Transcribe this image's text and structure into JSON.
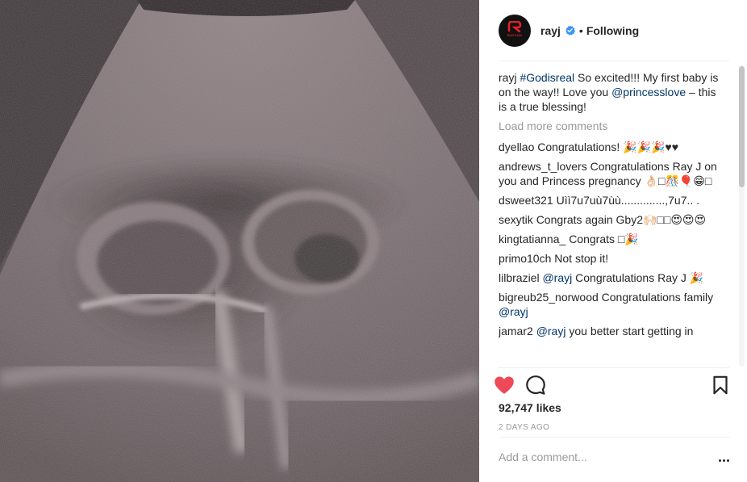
{
  "header": {
    "avatar_brand": "RAYCON",
    "username": "rayj",
    "separator": "•",
    "follow_state": "Following"
  },
  "caption": {
    "username": "rayj",
    "hashtag": "#Godisreal",
    "text_1": " So excited!!! My first baby is on the way!! Love you ",
    "mention": "@princesslove",
    "text_2": " – this is a true blessing!"
  },
  "load_more": "Load more comments",
  "comments": [
    {
      "username": "dyellao",
      "text": "Congratulations! 🎉🎉🎉♥♥"
    },
    {
      "username": "andrews_t_lovers",
      "text": "Congratulations Ray J on you and Princess pregnancy 👌🏻□🎊🎈😁□"
    },
    {
      "username": "dsweet321",
      "text": "Uìì7u7uù7ùù..............,7u7.. ."
    },
    {
      "username": "sexytik",
      "text": "Congrats again Gby2🙌🏻□□😍😍😍"
    },
    {
      "username": "kingtatianna_",
      "text": "Congrats □🎉"
    },
    {
      "username": "primo10ch",
      "text": "Not stop it!"
    },
    {
      "username": "lilbraziel",
      "mention": "@rayj",
      "text": " Congratulations Ray J 🎉"
    },
    {
      "username": "bigreub25_norwood",
      "text": "Congratulations family ",
      "mention": "@rayj"
    },
    {
      "username": "jamar2",
      "mention": "@rayj",
      "text": " you better start getting in"
    }
  ],
  "actions": {
    "like_icon": "heart-icon",
    "comment_icon": "comment-icon",
    "save_icon": "bookmark-icon"
  },
  "likes": "92,747 likes",
  "timestamp": "2 DAYS AGO",
  "add_comment": {
    "placeholder": "Add a comment..."
  },
  "colors": {
    "like_red": "#ed4956",
    "link_blue": "#003569",
    "verified_blue": "#3897f0",
    "muted_gray": "#999999"
  }
}
